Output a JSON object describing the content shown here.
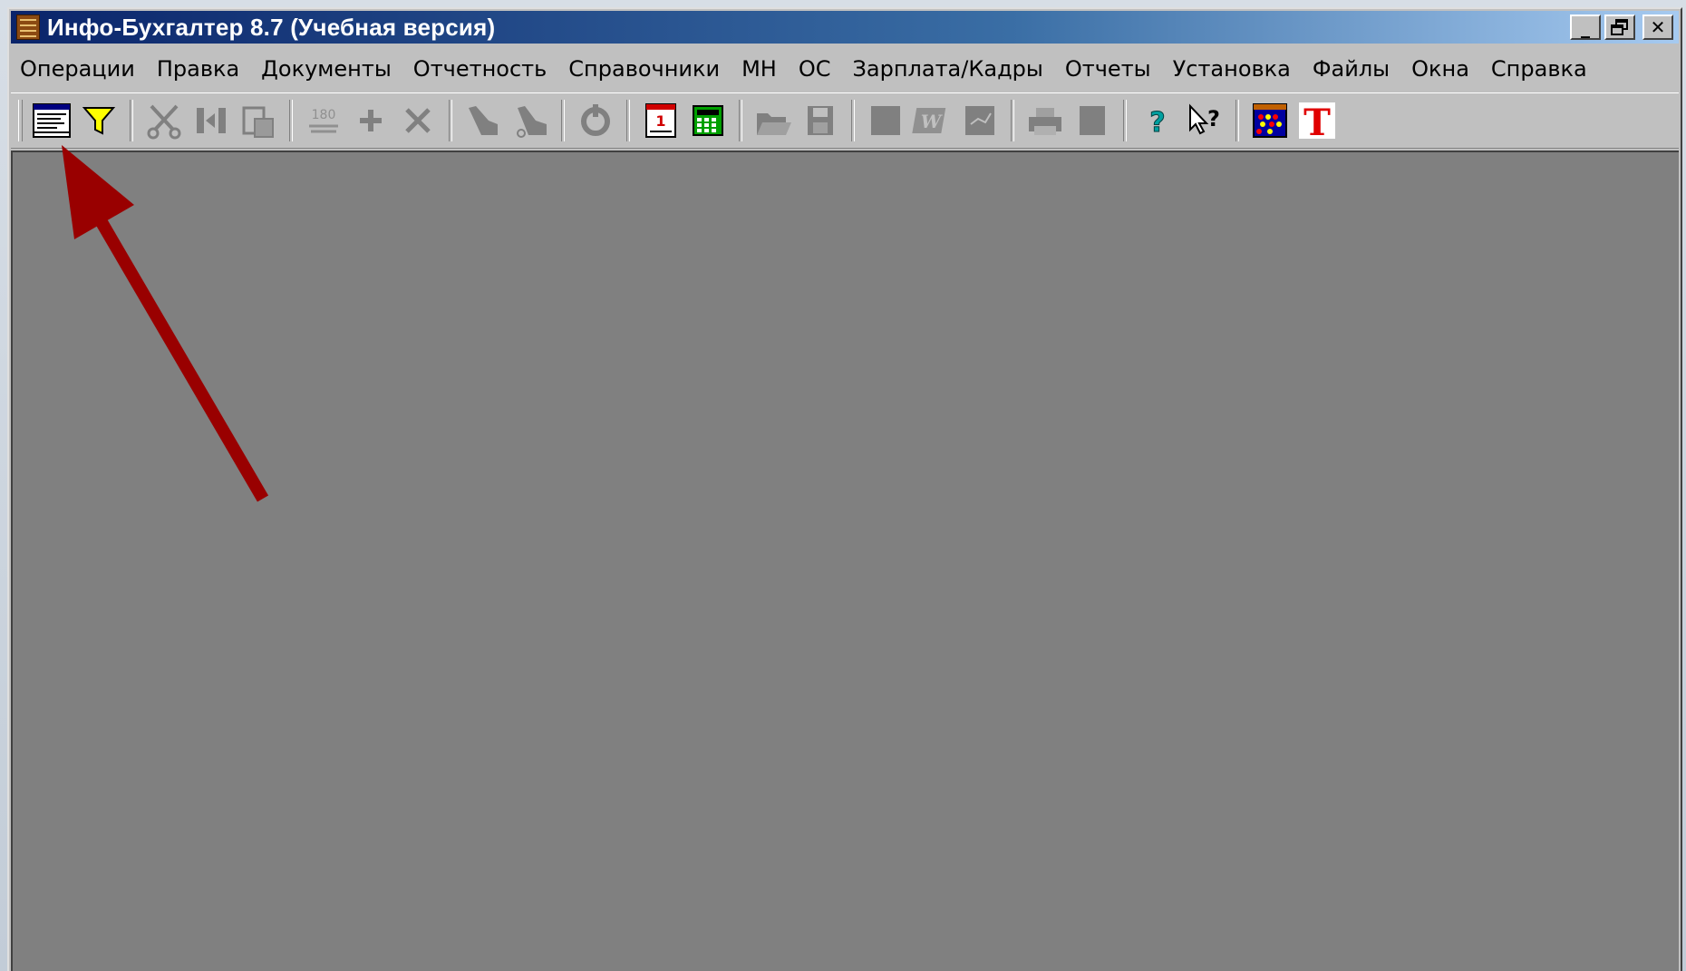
{
  "window": {
    "title": "Инфо-Бухгалтер 8.7 (Учебная версия)",
    "controls": {
      "minimize": "_",
      "restore": "🗗",
      "close": "✕"
    }
  },
  "menu": [
    "Операции",
    "Правка",
    "Документы",
    "Отчетность",
    "Справочники",
    "МН",
    "ОС",
    "Зарплата/Кадры",
    "Отчеты",
    "Установка",
    "Файлы",
    "Окна",
    "Справка"
  ],
  "toolbar": {
    "buttons": [
      {
        "icon": "journal-table-icon"
      },
      {
        "icon": "filter-funnel-icon"
      },
      {
        "icon": "cut-scissors-icon"
      },
      {
        "icon": "copy-icon"
      },
      {
        "icon": "paste-icon"
      },
      {
        "icon": "number-180-icon",
        "text": "180"
      },
      {
        "icon": "add-plus-icon"
      },
      {
        "icon": "delete-x-icon"
      },
      {
        "icon": "hand-pointer-icon"
      },
      {
        "icon": "hand-pointer-alt-icon"
      },
      {
        "icon": "refresh-icon"
      },
      {
        "icon": "calendar-icon",
        "text": "1"
      },
      {
        "icon": "calculator-icon"
      },
      {
        "icon": "open-folder-icon"
      },
      {
        "icon": "save-disk-icon"
      },
      {
        "icon": "block-icon"
      },
      {
        "icon": "word-icon",
        "text": "W"
      },
      {
        "icon": "excel-icon"
      },
      {
        "icon": "print-icon"
      },
      {
        "icon": "preview-icon"
      },
      {
        "icon": "help-icon",
        "text": "?"
      },
      {
        "icon": "context-help-icon",
        "text": "?"
      },
      {
        "icon": "abacus-icon"
      },
      {
        "icon": "info-t-logo-icon",
        "text": "T"
      }
    ]
  },
  "colors": {
    "mdi_background": "#808080",
    "arrow": "#990000",
    "face": "#c0c0c0"
  }
}
